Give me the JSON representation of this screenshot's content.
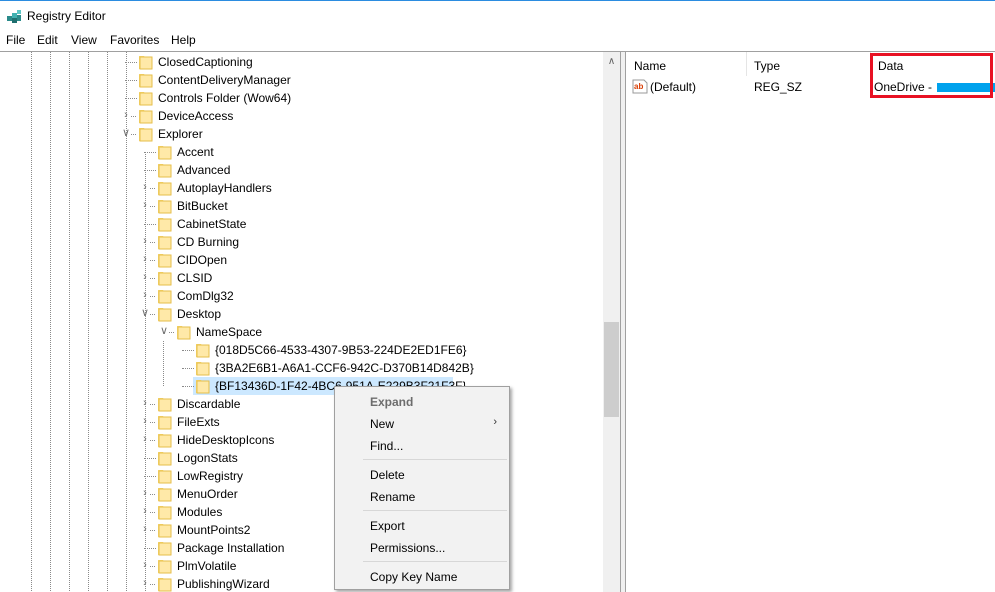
{
  "window": {
    "title": "Registry Editor",
    "icon": "registry-editor-icon"
  },
  "menubar": [
    {
      "label": "File"
    },
    {
      "label": "Edit"
    },
    {
      "label": "View"
    },
    {
      "label": "Favorites"
    },
    {
      "label": "Help"
    }
  ],
  "tree": {
    "rows": [
      {
        "label": "ClosedCaptioning",
        "level": 0,
        "expander": "none"
      },
      {
        "label": "ContentDeliveryManager",
        "level": 0,
        "expander": "none"
      },
      {
        "label": "Controls Folder (Wow64)",
        "level": 0,
        "expander": "none"
      },
      {
        "label": "DeviceAccess",
        "level": 0,
        "expander": "collapsed"
      },
      {
        "label": "Explorer",
        "level": 0,
        "expander": "expanded"
      },
      {
        "label": "Accent",
        "level": 1,
        "expander": "none"
      },
      {
        "label": "Advanced",
        "level": 1,
        "expander": "none"
      },
      {
        "label": "AutoplayHandlers",
        "level": 1,
        "expander": "collapsed"
      },
      {
        "label": "BitBucket",
        "level": 1,
        "expander": "collapsed"
      },
      {
        "label": "CabinetState",
        "level": 1,
        "expander": "none"
      },
      {
        "label": "CD Burning",
        "level": 1,
        "expander": "collapsed"
      },
      {
        "label": "CIDOpen",
        "level": 1,
        "expander": "collapsed"
      },
      {
        "label": "CLSID",
        "level": 1,
        "expander": "collapsed"
      },
      {
        "label": "ComDlg32",
        "level": 1,
        "expander": "collapsed"
      },
      {
        "label": "Desktop",
        "level": 1,
        "expander": "expanded"
      },
      {
        "label": "NameSpace",
        "level": 2,
        "expander": "expanded"
      },
      {
        "label": "{018D5C66-4533-4307-9B53-224DE2ED1FE6}",
        "level": 3,
        "expander": "none"
      },
      {
        "label": "{3BA2E6B1-A6A1-CCF6-942C-D370B14D842B}",
        "level": 3,
        "expander": "none"
      },
      {
        "label": "{BF13436D-1F42-4BC6-951A-E229B3F21F3F}",
        "level": 3,
        "expander": "none",
        "selected": true
      },
      {
        "label": "Discardable",
        "level": 1,
        "expander": "collapsed"
      },
      {
        "label": "FileExts",
        "level": 1,
        "expander": "collapsed"
      },
      {
        "label": "HideDesktopIcons",
        "level": 1,
        "expander": "collapsed"
      },
      {
        "label": "LogonStats",
        "level": 1,
        "expander": "none"
      },
      {
        "label": "LowRegistry",
        "level": 1,
        "expander": "none"
      },
      {
        "label": "MenuOrder",
        "level": 1,
        "expander": "collapsed"
      },
      {
        "label": "Modules",
        "level": 1,
        "expander": "collapsed"
      },
      {
        "label": "MountPoints2",
        "level": 1,
        "expander": "collapsed"
      },
      {
        "label": "Package Installation",
        "level": 1,
        "expander": "none"
      },
      {
        "label": "PlmVolatile",
        "level": 1,
        "expander": "collapsed"
      },
      {
        "label": "PublishingWizard",
        "level": 1,
        "expander": "collapsed"
      }
    ]
  },
  "list": {
    "columns": {
      "name": "Name",
      "type": "Type",
      "data": "Data"
    },
    "rows": [
      {
        "icon": "string-value-icon",
        "name": "(Default)",
        "type": "REG_SZ",
        "data": "OneDrive - ",
        "data_redacted": true
      }
    ]
  },
  "context_menu": {
    "items": [
      {
        "label": "Expand",
        "disabled": true
      },
      {
        "label": "New",
        "submenu": true
      },
      {
        "label": "Find..."
      },
      {
        "separator": true
      },
      {
        "label": "Delete"
      },
      {
        "label": "Rename"
      },
      {
        "separator": true
      },
      {
        "label": "Export"
      },
      {
        "label": "Permissions..."
      },
      {
        "separator": true
      },
      {
        "label": "Copy Key Name"
      }
    ]
  },
  "colors": {
    "selection": "#cce8ff",
    "highlight_box": "#e81123",
    "redaction": "#00a2ed",
    "folder": "#ffe08a"
  }
}
